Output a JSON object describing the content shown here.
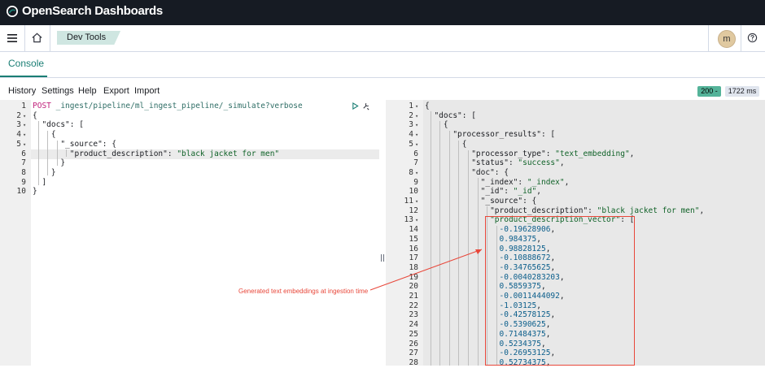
{
  "app": {
    "title": "OpenSearch Dashboards"
  },
  "header": {
    "breadcrumb": "Dev Tools",
    "avatar_initial": "m"
  },
  "tabs": [
    {
      "label": "Console",
      "active": true
    }
  ],
  "menu": {
    "items": [
      "History",
      "Settings",
      "Help",
      "Export",
      "Import"
    ]
  },
  "status": {
    "code": "200 -",
    "time": "1722 ms"
  },
  "request": {
    "lines": [
      {
        "n": "1",
        "fold": false,
        "parts": [
          [
            "method",
            "POST"
          ],
          [
            "url",
            " _ingest/pipeline/ml_ingest_pipeline/_simulate?verbose"
          ]
        ]
      },
      {
        "n": "2",
        "fold": true,
        "parts": [
          [
            "key",
            "{"
          ]
        ]
      },
      {
        "n": "3",
        "fold": true,
        "parts": [
          [
            "key",
            "  \"docs\": ["
          ]
        ]
      },
      {
        "n": "4",
        "fold": true,
        "parts": [
          [
            "key",
            "    {"
          ]
        ]
      },
      {
        "n": "5",
        "fold": true,
        "parts": [
          [
            "key",
            "      \"_source\": {"
          ]
        ]
      },
      {
        "n": "6",
        "fold": false,
        "parts": [
          [
            "key",
            "        \"product_description\": "
          ],
          [
            "str",
            "\"black jacket for men\""
          ]
        ]
      },
      {
        "n": "7",
        "fold": false,
        "parts": [
          [
            "key",
            "      }"
          ]
        ]
      },
      {
        "n": "8",
        "fold": false,
        "parts": [
          [
            "key",
            "    }"
          ]
        ]
      },
      {
        "n": "9",
        "fold": false,
        "parts": [
          [
            "key",
            "  ]"
          ]
        ]
      },
      {
        "n": "10",
        "fold": false,
        "parts": [
          [
            "key",
            "}"
          ]
        ]
      }
    ]
  },
  "response": {
    "lines": [
      {
        "n": "1",
        "fold": true,
        "parts": [
          [
            "key",
            "{"
          ]
        ]
      },
      {
        "n": "2",
        "fold": true,
        "parts": [
          [
            "key",
            "  \"docs\": ["
          ]
        ]
      },
      {
        "n": "3",
        "fold": true,
        "parts": [
          [
            "key",
            "    {"
          ]
        ]
      },
      {
        "n": "4",
        "fold": true,
        "parts": [
          [
            "key",
            "      \"processor_results\": ["
          ]
        ]
      },
      {
        "n": "5",
        "fold": true,
        "parts": [
          [
            "key",
            "        {"
          ]
        ]
      },
      {
        "n": "6",
        "fold": false,
        "parts": [
          [
            "key",
            "          \"processor_type\": "
          ],
          [
            "str",
            "\"text_embedding\""
          ],
          [
            "key",
            ","
          ]
        ]
      },
      {
        "n": "7",
        "fold": false,
        "parts": [
          [
            "key",
            "          \"status\": "
          ],
          [
            "str",
            "\"success\""
          ],
          [
            "key",
            ","
          ]
        ]
      },
      {
        "n": "8",
        "fold": true,
        "parts": [
          [
            "key",
            "          \"doc\": {"
          ]
        ]
      },
      {
        "n": "9",
        "fold": false,
        "parts": [
          [
            "key",
            "            \"_index\": "
          ],
          [
            "str",
            "\"_index\""
          ],
          [
            "key",
            ","
          ]
        ]
      },
      {
        "n": "10",
        "fold": false,
        "parts": [
          [
            "key",
            "            \"_id\": "
          ],
          [
            "str",
            "\"_id\""
          ],
          [
            "key",
            ","
          ]
        ]
      },
      {
        "n": "11",
        "fold": true,
        "parts": [
          [
            "key",
            "            \"_source\": {"
          ]
        ]
      },
      {
        "n": "12",
        "fold": false,
        "parts": [
          [
            "key",
            "              \"product_description\": "
          ],
          [
            "str",
            "\"black jacket for men\""
          ],
          [
            "key",
            ","
          ]
        ]
      },
      {
        "n": "13",
        "fold": true,
        "parts": [
          [
            "str",
            "              \"product_description_vector\""
          ],
          [
            "key",
            ": ["
          ]
        ]
      },
      {
        "n": "14",
        "fold": false,
        "parts": [
          [
            "num",
            "                -0.19628906"
          ],
          [
            "key",
            ","
          ]
        ]
      },
      {
        "n": "15",
        "fold": false,
        "parts": [
          [
            "num",
            "                0.984375"
          ],
          [
            "key",
            ","
          ]
        ]
      },
      {
        "n": "16",
        "fold": false,
        "parts": [
          [
            "num",
            "                0.98828125"
          ],
          [
            "key",
            ","
          ]
        ]
      },
      {
        "n": "17",
        "fold": false,
        "parts": [
          [
            "num",
            "                -0.10888672"
          ],
          [
            "key",
            ","
          ]
        ]
      },
      {
        "n": "18",
        "fold": false,
        "parts": [
          [
            "num",
            "                -0.34765625"
          ],
          [
            "key",
            ","
          ]
        ]
      },
      {
        "n": "19",
        "fold": false,
        "parts": [
          [
            "num",
            "                -0.0040283203"
          ],
          [
            "key",
            ","
          ]
        ]
      },
      {
        "n": "20",
        "fold": false,
        "parts": [
          [
            "num",
            "                0.5859375"
          ],
          [
            "key",
            ","
          ]
        ]
      },
      {
        "n": "21",
        "fold": false,
        "parts": [
          [
            "num",
            "                -0.0011444092"
          ],
          [
            "key",
            ","
          ]
        ]
      },
      {
        "n": "22",
        "fold": false,
        "parts": [
          [
            "num",
            "                -1.03125"
          ],
          [
            "key",
            ","
          ]
        ]
      },
      {
        "n": "23",
        "fold": false,
        "parts": [
          [
            "num",
            "                -0.42578125"
          ],
          [
            "key",
            ","
          ]
        ]
      },
      {
        "n": "24",
        "fold": false,
        "parts": [
          [
            "num",
            "                -0.5390625"
          ],
          [
            "key",
            ","
          ]
        ]
      },
      {
        "n": "25",
        "fold": false,
        "parts": [
          [
            "num",
            "                0.71484375"
          ],
          [
            "key",
            ","
          ]
        ]
      },
      {
        "n": "26",
        "fold": false,
        "parts": [
          [
            "num",
            "                0.5234375"
          ],
          [
            "key",
            ","
          ]
        ]
      },
      {
        "n": "27",
        "fold": false,
        "parts": [
          [
            "num",
            "                -0.26953125"
          ],
          [
            "key",
            ","
          ]
        ]
      },
      {
        "n": "28",
        "fold": false,
        "parts": [
          [
            "num",
            "                0.52734375"
          ],
          [
            "key",
            ","
          ]
        ]
      }
    ]
  },
  "annotation": {
    "text": "Generated text embeddings at ingestion time"
  },
  "colors": {
    "accent": "#1a7e74",
    "annotation": "#e8473a",
    "topbar": "#161b23",
    "success": "#54b399"
  }
}
